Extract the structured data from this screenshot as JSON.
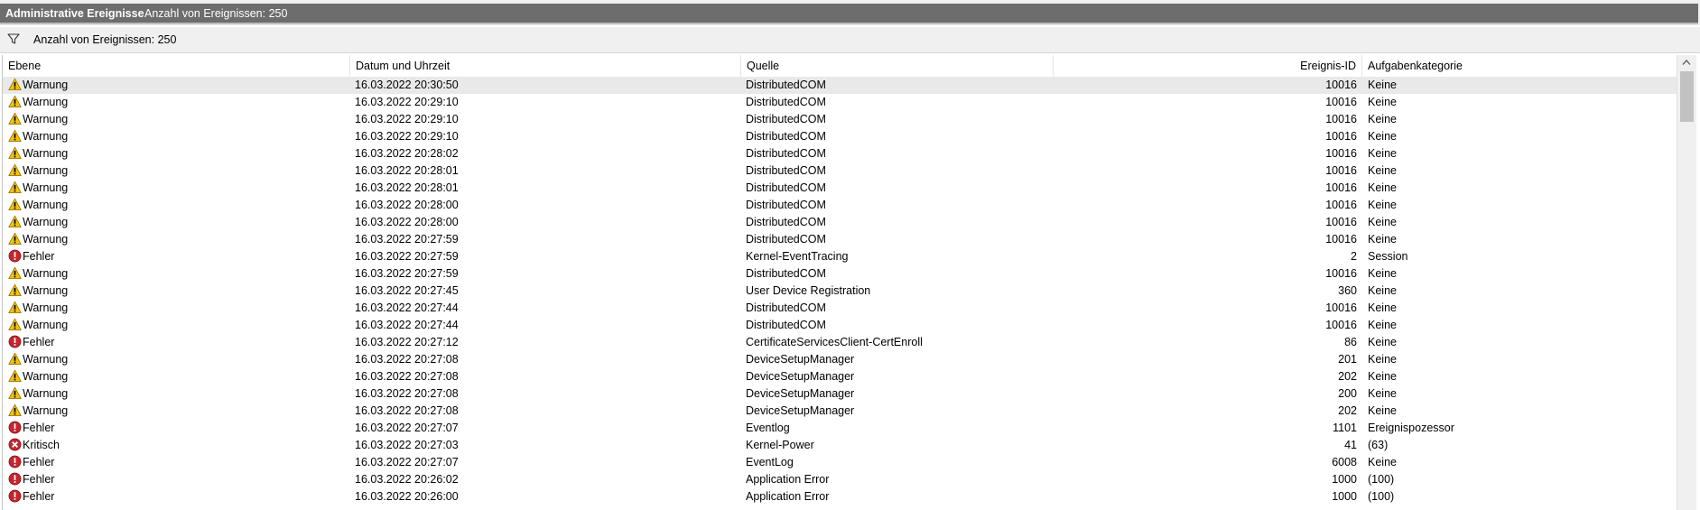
{
  "titlebar": {
    "title": "Administrative Ereignisse",
    "count": "Anzahl von Ereignissen: 250"
  },
  "filterbar": {
    "text": "Anzahl von Ereignissen: 250",
    "icon": "filter-icon"
  },
  "columns": {
    "level": "Ebene",
    "date": "Datum und Uhrzeit",
    "source": "Quelle",
    "eventid": "Ereignis-ID",
    "category": "Aufgabenkategorie"
  },
  "level_icons": {
    "Warnung": "warning-icon",
    "Fehler": "error-icon",
    "Kritisch": "critical-icon"
  },
  "colors": {
    "warning": "#f4c20d",
    "error": "#c4262e",
    "critical": "#c4262e",
    "selected_row": "#e9e9e9",
    "title_bar": "#6d6d6d"
  },
  "rows": [
    {
      "level": "Warnung",
      "date": "16.03.2022 20:30:50",
      "source": "DistributedCOM",
      "id": "10016",
      "category": "Keine"
    },
    {
      "level": "Warnung",
      "date": "16.03.2022 20:29:10",
      "source": "DistributedCOM",
      "id": "10016",
      "category": "Keine"
    },
    {
      "level": "Warnung",
      "date": "16.03.2022 20:29:10",
      "source": "DistributedCOM",
      "id": "10016",
      "category": "Keine"
    },
    {
      "level": "Warnung",
      "date": "16.03.2022 20:29:10",
      "source": "DistributedCOM",
      "id": "10016",
      "category": "Keine"
    },
    {
      "level": "Warnung",
      "date": "16.03.2022 20:28:02",
      "source": "DistributedCOM",
      "id": "10016",
      "category": "Keine"
    },
    {
      "level": "Warnung",
      "date": "16.03.2022 20:28:01",
      "source": "DistributedCOM",
      "id": "10016",
      "category": "Keine"
    },
    {
      "level": "Warnung",
      "date": "16.03.2022 20:28:01",
      "source": "DistributedCOM",
      "id": "10016",
      "category": "Keine"
    },
    {
      "level": "Warnung",
      "date": "16.03.2022 20:28:00",
      "source": "DistributedCOM",
      "id": "10016",
      "category": "Keine"
    },
    {
      "level": "Warnung",
      "date": "16.03.2022 20:28:00",
      "source": "DistributedCOM",
      "id": "10016",
      "category": "Keine"
    },
    {
      "level": "Warnung",
      "date": "16.03.2022 20:27:59",
      "source": "DistributedCOM",
      "id": "10016",
      "category": "Keine"
    },
    {
      "level": "Fehler",
      "date": "16.03.2022 20:27:59",
      "source": "Kernel-EventTracing",
      "id": "2",
      "category": "Session"
    },
    {
      "level": "Warnung",
      "date": "16.03.2022 20:27:59",
      "source": "DistributedCOM",
      "id": "10016",
      "category": "Keine"
    },
    {
      "level": "Warnung",
      "date": "16.03.2022 20:27:45",
      "source": "User Device Registration",
      "id": "360",
      "category": "Keine"
    },
    {
      "level": "Warnung",
      "date": "16.03.2022 20:27:44",
      "source": "DistributedCOM",
      "id": "10016",
      "category": "Keine"
    },
    {
      "level": "Warnung",
      "date": "16.03.2022 20:27:44",
      "source": "DistributedCOM",
      "id": "10016",
      "category": "Keine"
    },
    {
      "level": "Fehler",
      "date": "16.03.2022 20:27:12",
      "source": "CertificateServicesClient-CertEnroll",
      "id": "86",
      "category": "Keine"
    },
    {
      "level": "Warnung",
      "date": "16.03.2022 20:27:08",
      "source": "DeviceSetupManager",
      "id": "201",
      "category": "Keine"
    },
    {
      "level": "Warnung",
      "date": "16.03.2022 20:27:08",
      "source": "DeviceSetupManager",
      "id": "202",
      "category": "Keine"
    },
    {
      "level": "Warnung",
      "date": "16.03.2022 20:27:08",
      "source": "DeviceSetupManager",
      "id": "200",
      "category": "Keine"
    },
    {
      "level": "Warnung",
      "date": "16.03.2022 20:27:08",
      "source": "DeviceSetupManager",
      "id": "202",
      "category": "Keine"
    },
    {
      "level": "Fehler",
      "date": "16.03.2022 20:27:07",
      "source": "Eventlog",
      "id": "1101",
      "category": "Ereignispozessor"
    },
    {
      "level": "Kritisch",
      "date": "16.03.2022 20:27:03",
      "source": "Kernel-Power",
      "id": "41",
      "category": "(63)"
    },
    {
      "level": "Fehler",
      "date": "16.03.2022 20:27:07",
      "source": "EventLog",
      "id": "6008",
      "category": "Keine"
    },
    {
      "level": "Fehler",
      "date": "16.03.2022 20:26:02",
      "source": "Application Error",
      "id": "1000",
      "category": "(100)"
    },
    {
      "level": "Fehler",
      "date": "16.03.2022 20:26:00",
      "source": "Application Error",
      "id": "1000",
      "category": "(100)"
    }
  ]
}
